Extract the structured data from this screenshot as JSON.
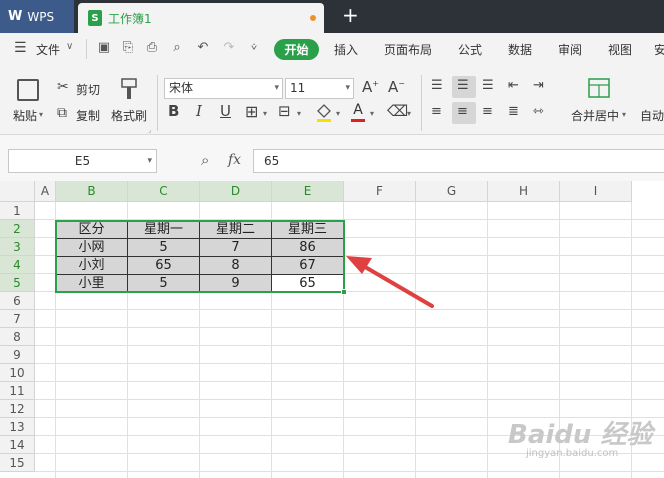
{
  "titlebar": {
    "app_name": "WPS",
    "doc_name": "工作簿1",
    "new_tab": "+"
  },
  "menu": {
    "file": "文件",
    "start": "开始",
    "insert": "插入",
    "page_layout": "页面布局",
    "formula": "公式",
    "data": "数据",
    "review": "审阅",
    "view": "视图",
    "security": "安"
  },
  "ribbon": {
    "paste": "粘贴",
    "cut": "剪切",
    "copy": "复制",
    "format_painter": "格式刷",
    "font_name": "宋体",
    "font_size": "11",
    "bold": "B",
    "italic": "I",
    "underline": "U",
    "font_color": "A",
    "merge_center": "合并居中",
    "auto_wrap": "自动"
  },
  "formula_bar": {
    "name_box": "E5",
    "fx": "fx",
    "value": "65"
  },
  "grid": {
    "columns": [
      "A",
      "B",
      "C",
      "D",
      "E",
      "F",
      "G",
      "H",
      "I"
    ],
    "rows": [
      "1",
      "2",
      "3",
      "4",
      "5",
      "6",
      "7",
      "8",
      "9",
      "10",
      "11",
      "12",
      "13",
      "14",
      "15"
    ],
    "table": [
      [
        "区分",
        "星期一",
        "星期二",
        "星期三"
      ],
      [
        "小网",
        "5",
        "7",
        "86"
      ],
      [
        "小刘",
        "65",
        "8",
        "67"
      ],
      [
        "小里",
        "5",
        "9",
        "65"
      ]
    ]
  },
  "watermark": {
    "brand": "Baidu 经验",
    "url": "jingyan.baidu.com"
  },
  "colors": {
    "accent": "#2aa04a",
    "arrow": "#e04040",
    "titlebar": "#2d3238"
  }
}
